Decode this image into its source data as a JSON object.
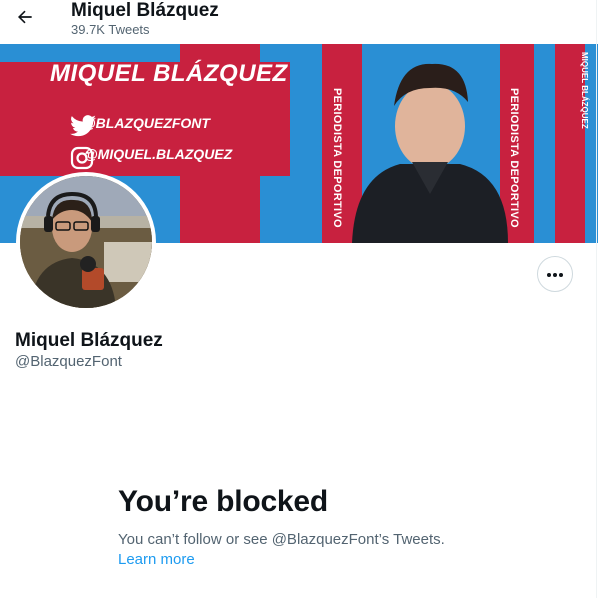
{
  "header": {
    "title": "Miquel Blázquez",
    "tweet_count": "39.7K Tweets"
  },
  "banner": {
    "headline": "MIQUEL BLÁZQUEZ",
    "twitter_handle": "@BLAZQUEZFONT",
    "instagram_handle": "@MIQUEL.BLAZQUEZ",
    "vertical_text": "PERIODISTA DEPORTIVO",
    "side_text": "MIQUEL BLÁZQUEZ",
    "colors": {
      "blue": "#2a8fd4",
      "red": "#c8213f"
    }
  },
  "profile": {
    "name": "Miquel Blázquez",
    "handle": "@BlazquezFont"
  },
  "blocked": {
    "heading": "You’re blocked",
    "message": "You can’t follow or see @BlazquezFont’s Tweets.",
    "learn_more": "Learn more"
  },
  "colors": {
    "accent": "#1d9bf0",
    "text_secondary": "#536471"
  }
}
